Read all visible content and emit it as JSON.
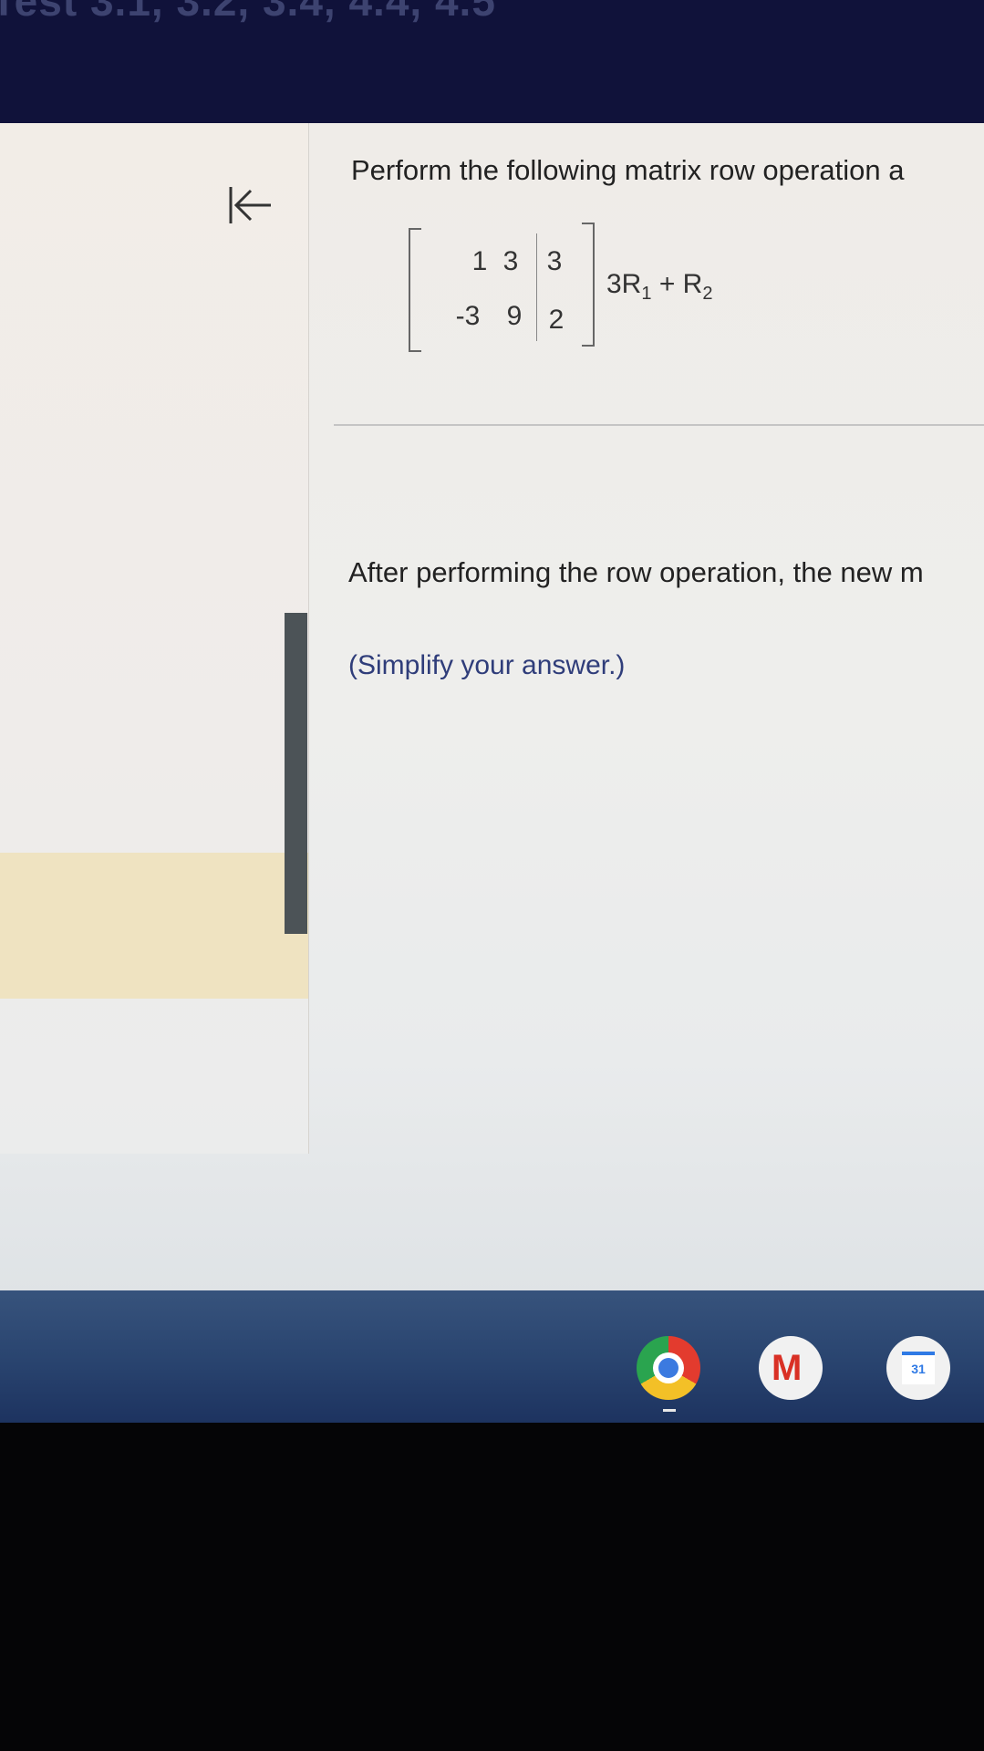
{
  "header": {
    "title": "Test 3.1, 3.2, 3.4, 4.4, 4.5"
  },
  "navigation": {
    "back_icon": "first-page-arrow-icon"
  },
  "question": {
    "prompt": "Perform the following matrix row operation a",
    "matrix": {
      "row1": [
        "1",
        "3",
        "3"
      ],
      "row2": [
        "-3",
        "9",
        "2"
      ]
    },
    "operation": {
      "coef": "3R",
      "sub1": "1",
      "plus": " + R",
      "sub2": "2"
    }
  },
  "answer_section": {
    "intro": "After performing the row operation, the new m",
    "hint": "(Simplify your answer.)"
  },
  "taskbar": {
    "icons": [
      "chrome-icon",
      "gmail-icon",
      "calendar-icon"
    ],
    "calendar_day": "31"
  },
  "colors": {
    "header_bg": "#10123a",
    "hint_text": "#2f3d7a",
    "highlight_row": "#efe3c1",
    "scrollbar": "#4c5357"
  }
}
